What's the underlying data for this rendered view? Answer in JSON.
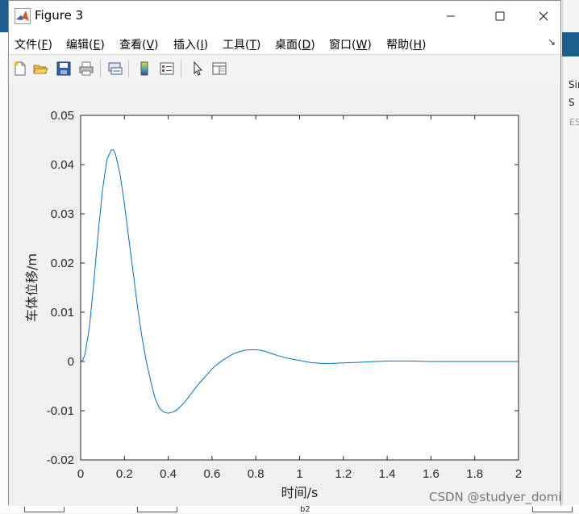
{
  "window": {
    "title": "Figure 3",
    "menu": [
      {
        "label": "文件(",
        "key": "F",
        "end": ")"
      },
      {
        "label": "编辑(",
        "key": "E",
        "end": ")"
      },
      {
        "label": "查看(",
        "key": "V",
        "end": ")"
      },
      {
        "label": "插入(",
        "key": "I",
        "end": ")"
      },
      {
        "label": "工具(",
        "key": "T",
        "end": ")"
      },
      {
        "label": "桌面(",
        "key": "D",
        "end": ")"
      },
      {
        "label": "窗口(",
        "key": "W",
        "end": ")"
      },
      {
        "label": "帮助(",
        "key": "H",
        "end": ")"
      }
    ],
    "toolbar_icons": [
      "new-figure-icon",
      "open-file-icon",
      "save-icon",
      "print-icon",
      "link-plot-icon",
      "colorbar-icon",
      "legend-icon",
      "edit-plot-icon",
      "property-inspector-icon"
    ]
  },
  "background": {
    "right_text_1": "Sir",
    "right_text_2": "S",
    "right_text_3": "ES",
    "bottom_text": "b2"
  },
  "chart_data": {
    "type": "line",
    "xlabel": "时间/s",
    "ylabel": "车体位移/m",
    "xlim": [
      0,
      2
    ],
    "ylim": [
      -0.02,
      0.05
    ],
    "xticks": [
      "0",
      "0.2",
      "0.4",
      "0.6",
      "0.8",
      "1",
      "1.2",
      "1.4",
      "1.6",
      "1.8",
      "2"
    ],
    "yticks": [
      "-0.02",
      "-0.01",
      "0",
      "0.01",
      "0.02",
      "0.03",
      "0.04",
      "0.05"
    ],
    "grid": false,
    "line_color": "#0072bd",
    "series": [
      {
        "x": [
          0,
          0.01,
          0.02,
          0.04,
          0.06,
          0.08,
          0.1,
          0.12,
          0.14,
          0.15,
          0.16,
          0.18,
          0.2,
          0.22,
          0.24,
          0.26,
          0.28,
          0.3,
          0.32,
          0.34,
          0.36,
          0.38,
          0.4,
          0.42,
          0.44,
          0.46,
          0.48,
          0.5,
          0.52,
          0.55,
          0.58,
          0.6,
          0.62,
          0.65,
          0.68,
          0.7,
          0.72,
          0.75,
          0.78,
          0.8,
          0.82,
          0.84,
          0.86,
          0.88,
          0.9,
          0.95,
          1.0,
          1.05,
          1.1,
          1.15,
          1.2,
          1.25,
          1.3,
          1.35,
          1.4,
          1.5,
          1.6,
          1.7,
          1.8,
          1.9,
          2.0
        ],
        "y": [
          0,
          0.0003,
          0.0015,
          0.007,
          0.016,
          0.026,
          0.035,
          0.041,
          0.043,
          0.043,
          0.042,
          0.038,
          0.032,
          0.025,
          0.018,
          0.011,
          0.005,
          0.0,
          -0.004,
          -0.0075,
          -0.0095,
          -0.0103,
          -0.0105,
          -0.0103,
          -0.0098,
          -0.009,
          -0.008,
          -0.0068,
          -0.0056,
          -0.004,
          -0.0025,
          -0.0015,
          -0.0007,
          0.0003,
          0.0011,
          0.0016,
          0.0019,
          0.0023,
          0.0024,
          0.0024,
          0.0023,
          0.0021,
          0.0018,
          0.0015,
          0.0012,
          0.0006,
          0.0002,
          -0.0002,
          -0.0004,
          -0.0004,
          -0.0003,
          -0.0002,
          -0.0001,
          0.0,
          0.0001,
          0.0001,
          0.0,
          0.0,
          0.0,
          0.0,
          0.0
        ]
      }
    ]
  },
  "watermark": "CSDN @studyer_domi"
}
